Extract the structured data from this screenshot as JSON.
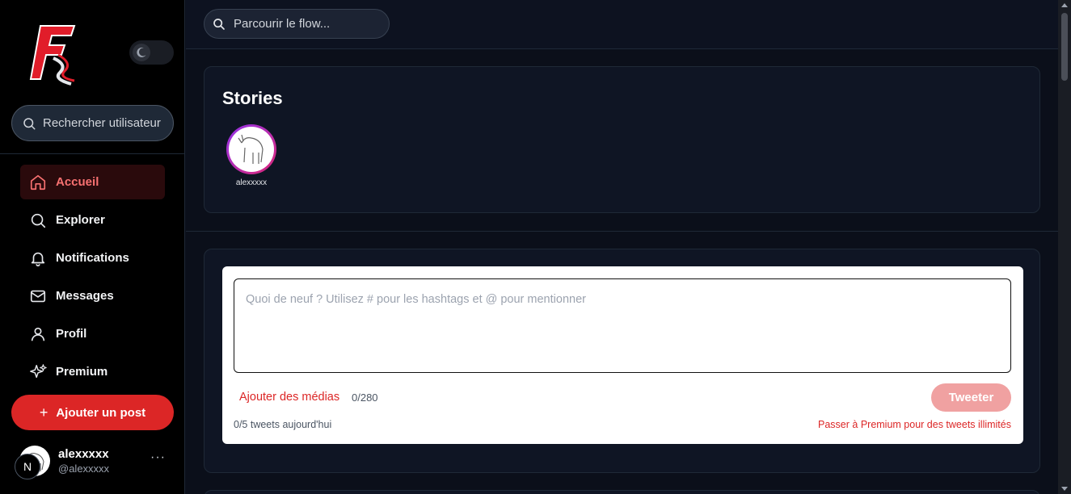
{
  "sidebar": {
    "logo_icon": "flow-f-logo",
    "theme_toggle_icon": "moon-icon",
    "user_search": {
      "placeholder": "Rechercher utilisateur"
    },
    "nav": [
      {
        "label": "Accueil",
        "icon": "home-icon",
        "active": true
      },
      {
        "label": "Explorer",
        "icon": "search-icon"
      },
      {
        "label": "Notifications",
        "icon": "bell-icon"
      },
      {
        "label": "Messages",
        "icon": "mail-icon"
      },
      {
        "label": "Profil",
        "icon": "user-icon"
      },
      {
        "label": "Premium",
        "icon": "sparkles-icon"
      }
    ],
    "add_post": {
      "label": "Ajouter un post",
      "icon": "plus-icon"
    },
    "profile": {
      "name": "alexxxxx",
      "handle": "@alexxxxx",
      "badge": "N",
      "more": "···"
    }
  },
  "topbar": {
    "search_placeholder": "Parcourir le flow..."
  },
  "stories": {
    "title": "Stories",
    "items": [
      {
        "username": "alexxxxx"
      }
    ]
  },
  "composer": {
    "placeholder": "Quoi de neuf ? Utilisez # pour les hashtags et @ pour mentionner",
    "value": "",
    "add_media": "Ajouter des médias",
    "counter": "0/280",
    "submit": "Tweeter",
    "daily_limit": "0/5 tweets aujourd'hui",
    "premium_cta": "Passer à Premium pour des tweets illimités"
  },
  "colors": {
    "accent": "#dc2626",
    "accent_light": "#f87171",
    "tweet_disabled": "#f0a1a1",
    "background": "#0b0f1a",
    "sidebar_bg": "#000000",
    "card_bg": "#0f1524"
  }
}
